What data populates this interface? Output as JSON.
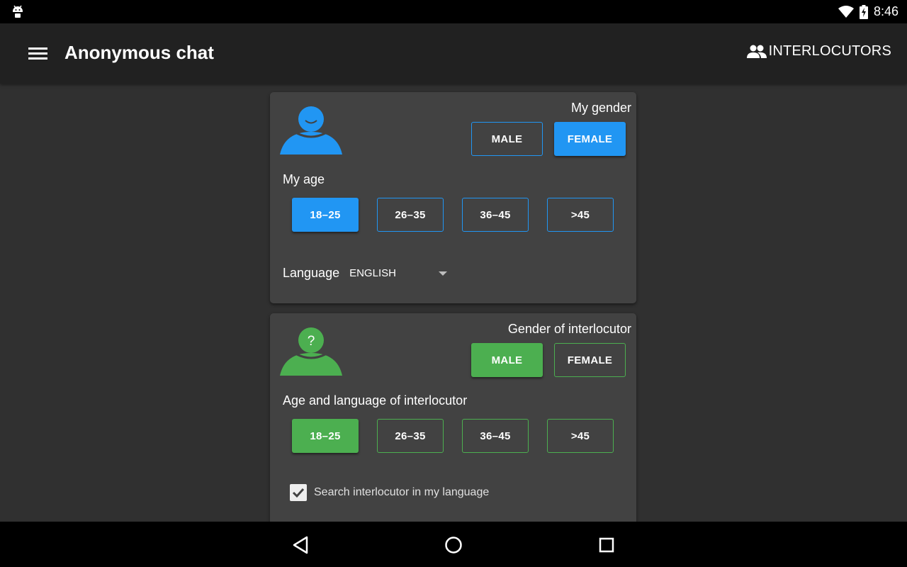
{
  "status_bar": {
    "time": "8:46",
    "icons": [
      "android-icon",
      "wifi-icon",
      "battery-charging-icon"
    ]
  },
  "app_bar": {
    "title": "Anonymous chat",
    "menu_icon": "menu-icon",
    "action_label": "INTERLOCUTORS",
    "action_icon": "people-icon"
  },
  "my_card": {
    "gender_label": "My gender",
    "gender_options": [
      "MALE",
      "FEMALE"
    ],
    "gender_selected": "FEMALE",
    "age_label": "My age",
    "age_options": [
      "18–25",
      "26–35",
      "36–45",
      ">45"
    ],
    "age_selected": "18–25",
    "language_label": "Language",
    "language_value": "ENGLISH",
    "accent_color": "#2196f3"
  },
  "interlocutor_card": {
    "gender_label": "Gender of interlocutor",
    "gender_options": [
      "MALE",
      "FEMALE"
    ],
    "gender_selected": "MALE",
    "age_label": "Age and language of interlocutor",
    "age_options": [
      "18–25",
      "26–35",
      "36–45",
      ">45"
    ],
    "age_selected": "18–25",
    "avatar_symbol": "?",
    "same_language_label": "Search interlocutor in my language",
    "same_language_checked": true,
    "accent_color": "#4caf50"
  },
  "nav_bar": {
    "icons": [
      "back-icon",
      "home-icon",
      "recents-icon"
    ]
  }
}
